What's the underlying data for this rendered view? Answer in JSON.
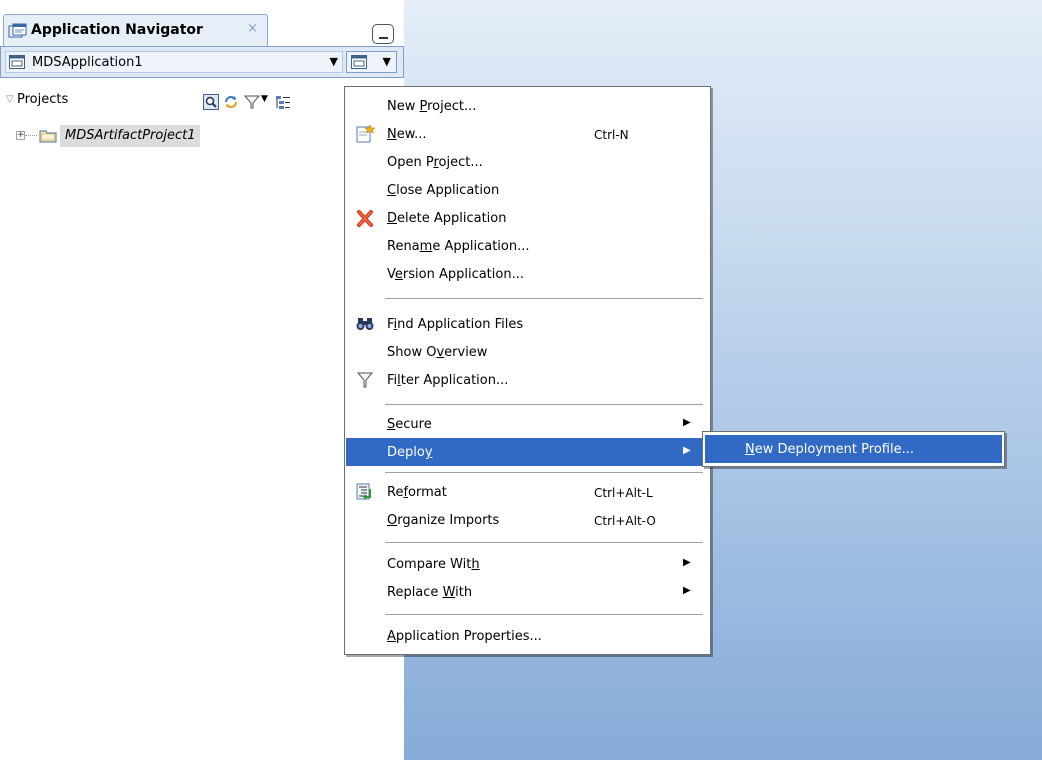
{
  "navigator": {
    "tab_title": "Application Navigator",
    "tab_close": "×",
    "application_name": "MDSApplication1",
    "projects_label": "Projects",
    "tree": [
      {
        "label": "MDSArtifactProject1"
      }
    ]
  },
  "context_menu": {
    "new_project": {
      "pre": "New ",
      "key": "P",
      "post": "roject..."
    },
    "new": {
      "pre": "",
      "key": "N",
      "post": "ew...",
      "shortcut": "Ctrl-N",
      "icon": "new-file-icon"
    },
    "open_project": {
      "pre": "Open P",
      "key": "r",
      "post": "oject..."
    },
    "close_application": {
      "pre": "",
      "key": "C",
      "post": "lose Application"
    },
    "delete_application": {
      "pre": "",
      "key": "D",
      "post": "elete Application",
      "icon": "delete-x-icon"
    },
    "rename_application": {
      "pre": "Rena",
      "key": "m",
      "post": "e Application..."
    },
    "version_application": {
      "pre": "V",
      "key": "e",
      "post": "rsion Application..."
    },
    "find_application_files": {
      "pre": "F",
      "key": "i",
      "post": "nd Application Files",
      "icon": "binoculars-icon"
    },
    "show_overview": {
      "pre": "Show O",
      "key": "v",
      "post": "erview"
    },
    "filter_application": {
      "pre": "Fi",
      "key": "l",
      "post": "ter Application...",
      "icon": "filter-icon"
    },
    "secure": {
      "pre": "",
      "key": "S",
      "post": "ecure"
    },
    "deploy": {
      "pre": "Deplo",
      "key": "y",
      "post": ""
    },
    "reformat": {
      "pre": "Re",
      "key": "f",
      "post": "ormat",
      "shortcut": "Ctrl+Alt-L",
      "icon": "reformat-icon"
    },
    "organize_imports": {
      "pre": "",
      "key": "O",
      "post": "rganize Imports",
      "shortcut": "Ctrl+Alt-O"
    },
    "compare_with": {
      "pre": "Compare Wit",
      "key": "h",
      "post": ""
    },
    "replace_with": {
      "pre": "Replace ",
      "key": "W",
      "post": "ith"
    },
    "application_properties": {
      "pre": "",
      "key": "A",
      "post": "pplication Properties..."
    },
    "submenu_arrow": "▶"
  },
  "deploy_submenu": {
    "new_deployment_profile": {
      "pre": "",
      "key": "N",
      "post": "ew Deployment Profile..."
    }
  },
  "colors": {
    "highlight": "#316ac5",
    "panel_border": "#7f9dc8",
    "editor_gradient_top": "#e4edf8",
    "editor_gradient_bottom": "#86abd8"
  }
}
